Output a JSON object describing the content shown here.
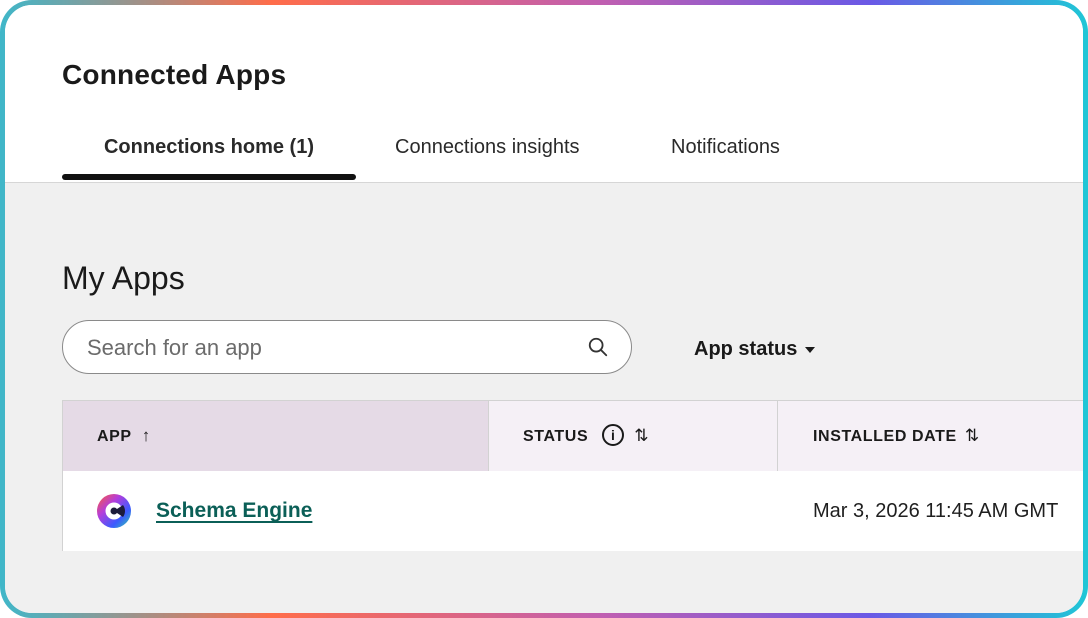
{
  "header": {
    "title": "Connected Apps",
    "tabs": [
      {
        "label": "Connections home (1)",
        "active": true
      },
      {
        "label": "Connections insights",
        "active": false
      },
      {
        "label": "Notifications",
        "active": false
      }
    ]
  },
  "main": {
    "section_title": "My Apps",
    "search": {
      "placeholder": "Search for an app",
      "value": "",
      "icon": "search-icon"
    },
    "filter": {
      "label": "App status",
      "icon": "caret-down-icon"
    },
    "table": {
      "columns": [
        {
          "label": "APP",
          "sort_icon": "↑"
        },
        {
          "label": "STATUS",
          "info_icon": "i",
          "sort_icon": "⇅"
        },
        {
          "label": "INSTALLED DATE",
          "sort_icon": "⇅"
        }
      ],
      "rows": [
        {
          "app": "Schema Engine",
          "status": "",
          "installed": "Mar 3, 2026 11:45 AM GMT"
        }
      ]
    }
  },
  "colors": {
    "link": "#0b5f57",
    "header_active_col": "#e5dae6",
    "header_col": "#f5f0f6",
    "background": "#f0f0f0"
  }
}
